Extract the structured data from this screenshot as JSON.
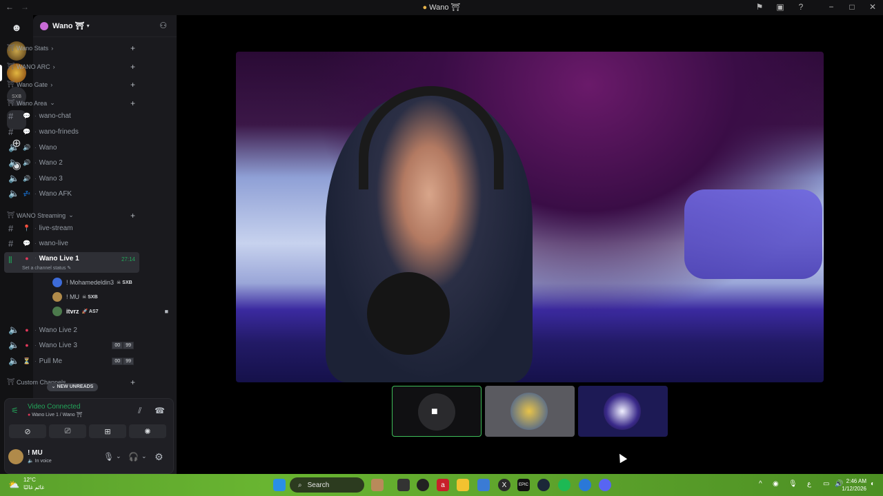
{
  "window": {
    "title": "Wano ⛩",
    "icon": "discord-logo"
  },
  "server": {
    "name": "Wano ⛩"
  },
  "categories": [
    {
      "name": "Wano Stats"
    },
    {
      "name": "WANO ARC"
    },
    {
      "name": "Wano Gate"
    },
    {
      "name": "Wano Area"
    },
    {
      "name": "WANO Streaming"
    },
    {
      "name": "Custom Channels"
    }
  ],
  "channels": {
    "wano_chat": "wano-chat",
    "wano_frineds": "wano-frineds",
    "wano": "Wano",
    "wano2": "Wano 2",
    "wano3": "Wano 3",
    "wano_afk": "Wano AFK",
    "live_stream": "live-stream",
    "wano_live": "wano-live",
    "wano_live1": "Wano Live 1",
    "wano_live1_time": "27:14",
    "wano_live1_status": "Set a channel status",
    "wano_live2": "Wano Live 2",
    "wano_live3": "Wano Live 3",
    "pull_me": "Pull Me"
  },
  "voice_users": [
    {
      "name": "! Mohamedeldin3",
      "tag": "SXB"
    },
    {
      "name": "! MU",
      "tag": "SXB"
    },
    {
      "name": "itvrz",
      "tag": "AS7"
    }
  ],
  "user_limit_pills": {
    "a": "00",
    "b": "99"
  },
  "new_unreads": "NEW UNREADS",
  "voice_panel": {
    "status": "Video Connected",
    "location": "Wano Live 1 / Wano ⛩"
  },
  "me": {
    "name": "! MU",
    "status": "In voice"
  },
  "taskbar": {
    "search_placeholder": "Search",
    "weather_temp": "12°C",
    "weather_desc": "غائم غالبًا",
    "time": "2:46 AM",
    "date": "1/12/2026",
    "lang": "ع"
  },
  "colors": {
    "green": "#23a55a",
    "accent": "#5865f2"
  }
}
